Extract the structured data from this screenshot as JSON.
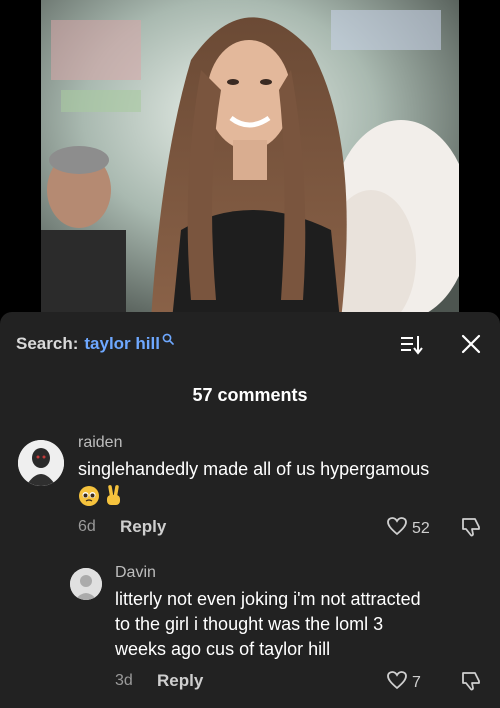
{
  "search": {
    "prefix": "Search:",
    "term": "taylor hill"
  },
  "comments_header": {
    "count_label": "57 comments"
  },
  "comments": [
    {
      "username": "raiden",
      "text": "singlehandedly made all of us hypergamous",
      "emoji": [
        "pleading-face",
        "victory-hand"
      ],
      "time": "6d",
      "reply_label": "Reply",
      "likes": "52"
    },
    {
      "username": "Davin",
      "text_lines": [
        "litterly not even joking i'm not attracted",
        "to the girl i thought was the loml 3",
        "weeks ago cus of taylor hill"
      ],
      "time": "3d",
      "reply_label": "Reply",
      "likes": "7"
    }
  ],
  "colors": {
    "sheet_bg": "#222222",
    "search_term": "#6ea8ff",
    "meta": "#9a9a9a"
  },
  "icons": [
    "search-icon",
    "sort-icon",
    "close-icon",
    "heart-icon",
    "dislike-icon",
    "avatar-placeholder-icon"
  ]
}
